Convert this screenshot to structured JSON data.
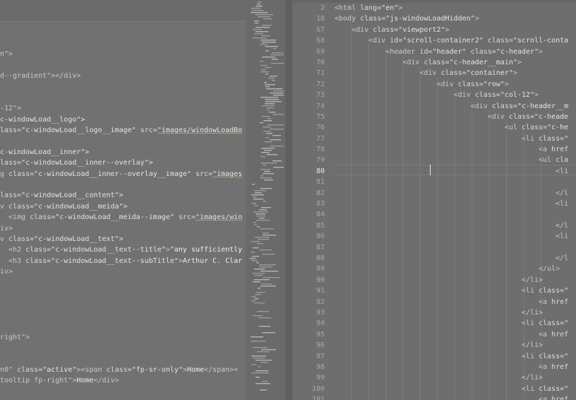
{
  "left_lines": [
    [],
    [
      [
        "t",
        "n\">"
      ]
    ],
    [],
    [
      [
        "t",
        "d--gradient\"></div>"
      ]
    ],
    [],
    [],
    [
      [
        "t",
        "-12\">"
      ]
    ],
    [
      [
        "s",
        "c-windowLoad__logo\">"
      ]
    ],
    [
      [
        "a",
        "lass="
      ],
      [
        "s",
        "\"c-windowLoad__logo__image\""
      ],
      [
        "a",
        " src="
      ],
      [
        "l",
        "\"images/windowLoadBo"
      ]
    ],
    [],
    [
      [
        "s",
        "c-windowLoad__inner\">"
      ]
    ],
    [
      [
        "a",
        "lass="
      ],
      [
        "s",
        "\"c-windowLoad__inner--overlay\">"
      ]
    ],
    [
      [
        "t",
        "g "
      ],
      [
        "a",
        "class="
      ],
      [
        "s",
        "\"c-windowLoad__inner--overlay__image\""
      ],
      [
        "a",
        " src="
      ],
      [
        "l",
        "\"images"
      ]
    ],
    [],
    [
      [
        "a",
        "lass="
      ],
      [
        "s",
        "\"c-windowLoad__content\">"
      ]
    ],
    [
      [
        "t",
        "v "
      ],
      [
        "a",
        "class="
      ],
      [
        "s",
        "\"c-windowLoad__meida\">"
      ]
    ],
    [
      [
        "t",
        "  <img "
      ],
      [
        "a",
        "class="
      ],
      [
        "s",
        "\"c-windowLoad__meida--image\""
      ],
      [
        "a",
        " src="
      ],
      [
        "l",
        "\"images/win"
      ]
    ],
    [
      [
        "t",
        "iv>"
      ]
    ],
    [
      [
        "t",
        "v "
      ],
      [
        "a",
        "class="
      ],
      [
        "s",
        "\"c-windowLoad__text\">"
      ]
    ],
    [
      [
        "t",
        "  <h2 "
      ],
      [
        "a",
        "class="
      ],
      [
        "s",
        "\"c-windowLoad__text--title\""
      ],
      [
        "t",
        ">"
      ],
      [
        "x",
        "\"any sufficiently"
      ]
    ],
    [
      [
        "t",
        "  <h3 "
      ],
      [
        "a",
        "class="
      ],
      [
        "s",
        "\"c-windowLoad__text--subTitle\""
      ],
      [
        "t",
        ">"
      ],
      [
        "x",
        "Arthur C. Clar"
      ]
    ],
    [
      [
        "t",
        "iv>"
      ]
    ],
    [],
    [],
    [],
    [],
    [],
    [
      [
        "t",
        "right\">"
      ]
    ],
    [],
    [],
    [
      [
        "t",
        "n0\" "
      ],
      [
        "a",
        "class="
      ],
      [
        "s",
        "\"active\""
      ],
      [
        "t",
        "><span "
      ],
      [
        "a",
        "class="
      ],
      [
        "s",
        "\"fp-sr-only\""
      ],
      [
        "t",
        ">"
      ],
      [
        "x",
        "Home"
      ],
      [
        "t",
        "</span><"
      ]
    ],
    [
      [
        "t",
        "tooltip fp-right\">"
      ],
      [
        "x",
        "Home"
      ],
      [
        "t",
        "</div>"
      ]
    ]
  ],
  "right_lines": [
    {
      "n": "2",
      "c": [
        [
          "t",
          "<html "
        ],
        [
          "a",
          "lang="
        ],
        [
          "s",
          "\"en\""
        ],
        [
          "t",
          ">"
        ]
      ]
    },
    {
      "n": "18",
      "c": [
        [
          "t",
          "<body "
        ],
        [
          "a",
          "class="
        ],
        [
          "s",
          "\"js-windowLoadHidden\""
        ],
        [
          "t",
          ">"
        ]
      ]
    },
    {
      "n": "67",
      "c": [
        [
          "t",
          "    <div "
        ],
        [
          "a",
          "class="
        ],
        [
          "s",
          "\"viewport2\""
        ],
        [
          "t",
          ">"
        ]
      ]
    },
    {
      "n": "68",
      "c": [
        [
          "t",
          "        <div "
        ],
        [
          "a",
          "id="
        ],
        [
          "s",
          "\"scroll-container2\""
        ],
        [
          "a",
          " class="
        ],
        [
          "s",
          "\"scroll-conta"
        ]
      ]
    },
    {
      "n": "69",
      "c": [
        [
          "t",
          "            <header "
        ],
        [
          "a",
          "id="
        ],
        [
          "s",
          "\"header\""
        ],
        [
          "a",
          " class="
        ],
        [
          "s",
          "\"c-header\""
        ],
        [
          "t",
          ">"
        ]
      ]
    },
    {
      "n": "70",
      "c": [
        [
          "t",
          "                <div "
        ],
        [
          "a",
          "class="
        ],
        [
          "s",
          "\"c-header__main\""
        ],
        [
          "t",
          ">"
        ]
      ]
    },
    {
      "n": "71",
      "c": [
        [
          "t",
          "                    <div "
        ],
        [
          "a",
          "class="
        ],
        [
          "s",
          "\"container\""
        ],
        [
          "t",
          ">"
        ]
      ]
    },
    {
      "n": "72",
      "c": [
        [
          "t",
          "                        <div "
        ],
        [
          "a",
          "class="
        ],
        [
          "s",
          "\"row\""
        ],
        [
          "t",
          ">"
        ]
      ]
    },
    {
      "n": "73",
      "c": [
        [
          "t",
          "                            <div "
        ],
        [
          "a",
          "class="
        ],
        [
          "s",
          "\"col-12\""
        ],
        [
          "t",
          ">"
        ]
      ]
    },
    {
      "n": "74",
      "c": [
        [
          "t",
          "                                <div "
        ],
        [
          "a",
          "class="
        ],
        [
          "s",
          "\"c-header__m"
        ]
      ]
    },
    {
      "n": "75",
      "c": [
        [
          "t",
          "                                    <div "
        ],
        [
          "a",
          "class="
        ],
        [
          "s",
          "\"c-heade"
        ]
      ]
    },
    {
      "n": "76",
      "c": [
        [
          "t",
          "                                        <ul "
        ],
        [
          "a",
          "class="
        ],
        [
          "s",
          "\"c-he"
        ]
      ]
    },
    {
      "n": "77",
      "c": [
        [
          "t",
          "                                            <li "
        ],
        [
          "a",
          "class="
        ],
        [
          "s",
          "\""
        ]
      ]
    },
    {
      "n": "78",
      "c": [
        [
          "t",
          "                                                <a "
        ],
        [
          "a",
          "href"
        ]
      ]
    },
    {
      "n": "79",
      "c": [
        [
          "t",
          "                                                <ul "
        ],
        [
          "a",
          "cla"
        ]
      ]
    },
    {
      "n": "80",
      "c": [
        [
          "t",
          "                                                    <li"
        ]
      ]
    },
    {
      "n": "81",
      "c": []
    },
    {
      "n": "82",
      "c": [
        [
          "t",
          "                                                    </l"
        ]
      ]
    },
    {
      "n": "83",
      "c": [
        [
          "t",
          "                                                    <li"
        ]
      ]
    },
    {
      "n": "84",
      "c": []
    },
    {
      "n": "85",
      "c": [
        [
          "t",
          "                                                    </l"
        ]
      ]
    },
    {
      "n": "86",
      "c": [
        [
          "t",
          "                                                    <li"
        ]
      ]
    },
    {
      "n": "87",
      "c": []
    },
    {
      "n": "88",
      "c": [
        [
          "t",
          "                                                    </l"
        ]
      ]
    },
    {
      "n": "89",
      "c": [
        [
          "t",
          "                                                </ul>"
        ]
      ]
    },
    {
      "n": "90",
      "c": [
        [
          "t",
          "                                            </li>"
        ]
      ]
    },
    {
      "n": "91",
      "c": [
        [
          "t",
          "                                            <li "
        ],
        [
          "a",
          "class="
        ],
        [
          "s",
          "\""
        ]
      ]
    },
    {
      "n": "92",
      "c": [
        [
          "t",
          "                                                <a "
        ],
        [
          "a",
          "href"
        ]
      ]
    },
    {
      "n": "93",
      "c": [
        [
          "t",
          "                                            </li>"
        ]
      ]
    },
    {
      "n": "94",
      "c": [
        [
          "t",
          "                                            <li "
        ],
        [
          "a",
          "class="
        ],
        [
          "s",
          "\""
        ]
      ]
    },
    {
      "n": "95",
      "c": [
        [
          "t",
          "                                                <a "
        ],
        [
          "a",
          "href"
        ]
      ]
    },
    {
      "n": "96",
      "c": [
        [
          "t",
          "                                            </li>"
        ]
      ]
    },
    {
      "n": "97",
      "c": [
        [
          "t",
          "                                            <li "
        ],
        [
          "a",
          "class="
        ],
        [
          "s",
          "\""
        ]
      ]
    },
    {
      "n": "98",
      "c": [
        [
          "t",
          "                                                <a "
        ],
        [
          "a",
          "href"
        ]
      ]
    },
    {
      "n": "99",
      "c": [
        [
          "t",
          "                                            </li>"
        ]
      ]
    },
    {
      "n": "100",
      "c": [
        [
          "t",
          "                                            <li "
        ],
        [
          "a",
          "class="
        ],
        [
          "s",
          "\""
        ]
      ]
    },
    {
      "n": "101",
      "c": [
        [
          "t",
          "                                                <a "
        ],
        [
          "a",
          "href"
        ]
      ]
    }
  ],
  "current_line": "80",
  "colors": {
    "editor_bg": "#6e6e6e",
    "tag": "#c9c9c9",
    "attribute": "#dadada",
    "string": "#e3e3e3",
    "text": "#ededed",
    "line_number": "#a8a8a8",
    "caret": "#eaeaea"
  }
}
